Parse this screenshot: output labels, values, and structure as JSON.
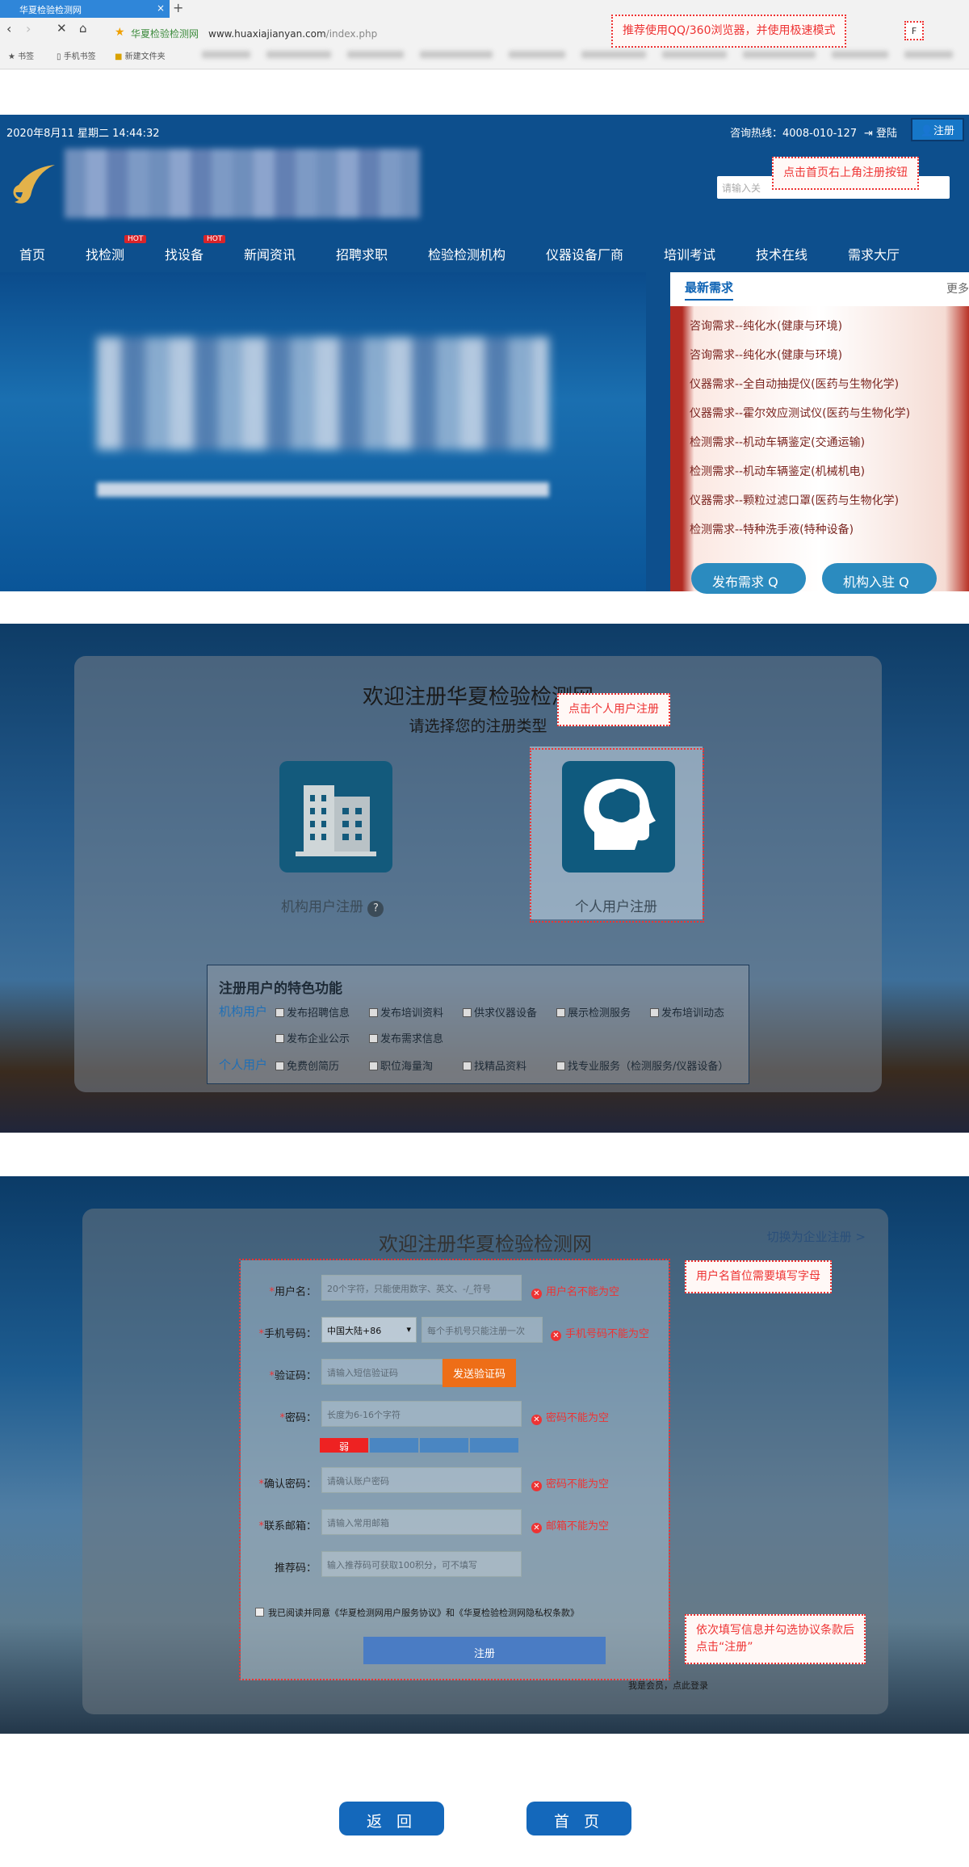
{
  "browser": {
    "tab_title": "华夏检验检测网",
    "tab_close": "×",
    "new_tab": "+",
    "site_name": "华夏检验检测网",
    "url_domain": "www.huaxiajianyan.com",
    "url_path": "/index.php",
    "bookmarks": [
      "书签",
      "手机书签",
      "新建文件夹"
    ],
    "extension_icon": "F"
  },
  "callouts": {
    "browser_tip": "推荐使用QQ/360浏览器，并使用极速模式",
    "step1": "点击首页右上角注册按钮",
    "step2": "点击个人用户注册",
    "step3": "用户名首位需要填写字母",
    "step4_line1": "依次填写信息并勾选协议条款后",
    "step4_line2": "点击“注册”"
  },
  "homepage": {
    "datetime": "2020年8月11 星期二 14:44:32",
    "hotline": "咨询热线：4008-010-127",
    "login": "登陆",
    "register": "注册",
    "search_placeholder": "请输入关",
    "nav": [
      "首页",
      "找检测",
      "找设备",
      "新闻资讯",
      "招聘求职",
      "检验检测机构",
      "仪器设备厂商",
      "培训考试",
      "技术在线",
      "需求大厅"
    ],
    "hot_badge": "HOT",
    "latest_needs_title": "最新需求",
    "more": "更多",
    "needs": [
      "咨询需求--纯化水(健康与环境)",
      "咨询需求--纯化水(健康与环境)",
      "仪器需求--全自动抽提仪(医药与生物化学)",
      "仪器需求--霍尔效应测试仪(医药与生物化学)",
      "检测需求--机动车辆鉴定(交通运输)",
      "检测需求--机动车辆鉴定(机械机电)",
      "仪器需求--颗粒过滤口罩(医药与生物化学)",
      "检测需求--特种洗手液(特种设备)"
    ],
    "publish_need": "发布需求",
    "org_join": "机构入驻"
  },
  "select_type": {
    "title": "欢迎注册华夏检验检测网",
    "subtitle": "请选择您的注册类型",
    "org_label": "机构用户注册",
    "personal_label": "个人用户注册",
    "help": "?",
    "features_title": "注册用户的特色功能",
    "org_kind": "机构用户",
    "personal_kind": "个人用户",
    "org_features_row1": [
      "发布招聘信息",
      "发布培训资料",
      "供求仪器设备",
      "展示检测服务",
      "发布培训动态"
    ],
    "org_features_row2": [
      "发布企业公示",
      "发布需求信息"
    ],
    "personal_features": [
      "免费创简历",
      "职位海量淘",
      "找精品资料",
      "找专业服务（检测服务/仪器设备）"
    ]
  },
  "reg_form": {
    "title": "欢迎注册华夏检验检测网",
    "switch_link": "切换为企业注册 >",
    "username_label": "用户名：",
    "username_placeholder": "20个字符，只能使用数字、英文、-/_符号",
    "username_error": "用户名不能为空",
    "phone_label": "手机号码：",
    "country": "中国大陆+86",
    "phone_placeholder": "每个手机号只能注册一次",
    "phone_error": "手机号码不能为空",
    "code_label": "验证码：",
    "code_placeholder": "请输入短信验证码",
    "send_code": "发送验证码",
    "password_label": "密码：",
    "password_placeholder": "长度为6-16个字符",
    "password_error": "密码不能为空",
    "strength_weak": "弱",
    "confirm_label": "确认密码：",
    "confirm_placeholder": "请确认账户密码",
    "confirm_error": "密码不能为空",
    "email_label": "联系邮箱：",
    "email_placeholder": "请输入常用邮箱",
    "email_error": "邮箱不能为空",
    "referrer_label": "推荐码：",
    "referrer_placeholder": "输入推荐码可获取100积分，可不填写",
    "agree_text": "我已阅读并同意《华夏检测网用户服务协议》和《华夏检验检测网隐私权条款》",
    "submit": "注册",
    "login_hint": "我是会员，点此登录",
    "required_mark": "*",
    "error_icon": "✕"
  },
  "footer": {
    "back": "返 回",
    "home": "首 页"
  },
  "colors": {
    "accent": "#1468bb",
    "error": "#ee3333",
    "send_button": "#ee6e17"
  }
}
